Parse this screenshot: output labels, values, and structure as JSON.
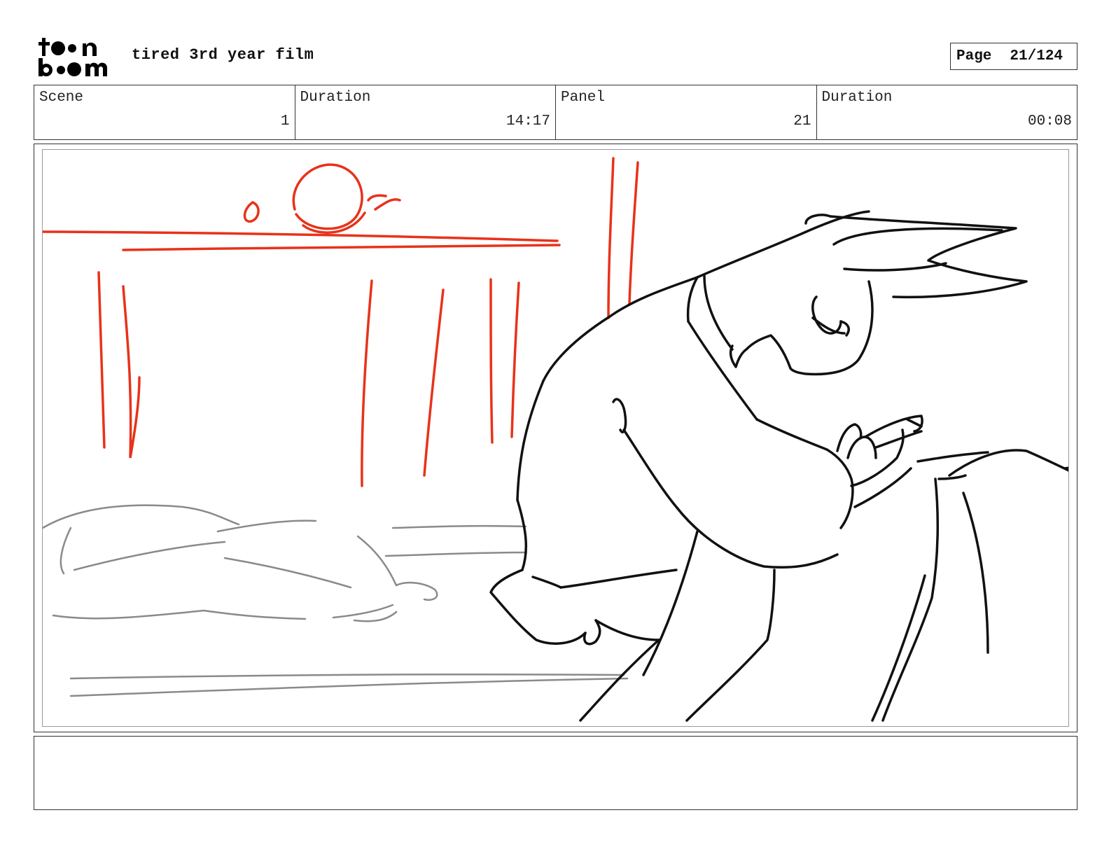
{
  "header": {
    "logo_text": "toon boom",
    "project_title": "tired 3rd year film",
    "page_label": "Page",
    "page_value": "21/124"
  },
  "info": [
    {
      "label": "Scene",
      "value": "1"
    },
    {
      "label": "Duration",
      "value": "14:17"
    },
    {
      "label": "Panel",
      "value": "21"
    },
    {
      "label": "Duration",
      "value": "00:08"
    }
  ],
  "panel": {
    "colors": {
      "layout_red": "#e8321a",
      "character_line": "#111111",
      "background_gray": "#8a8a8a"
    }
  },
  "notes": {
    "text": ""
  }
}
